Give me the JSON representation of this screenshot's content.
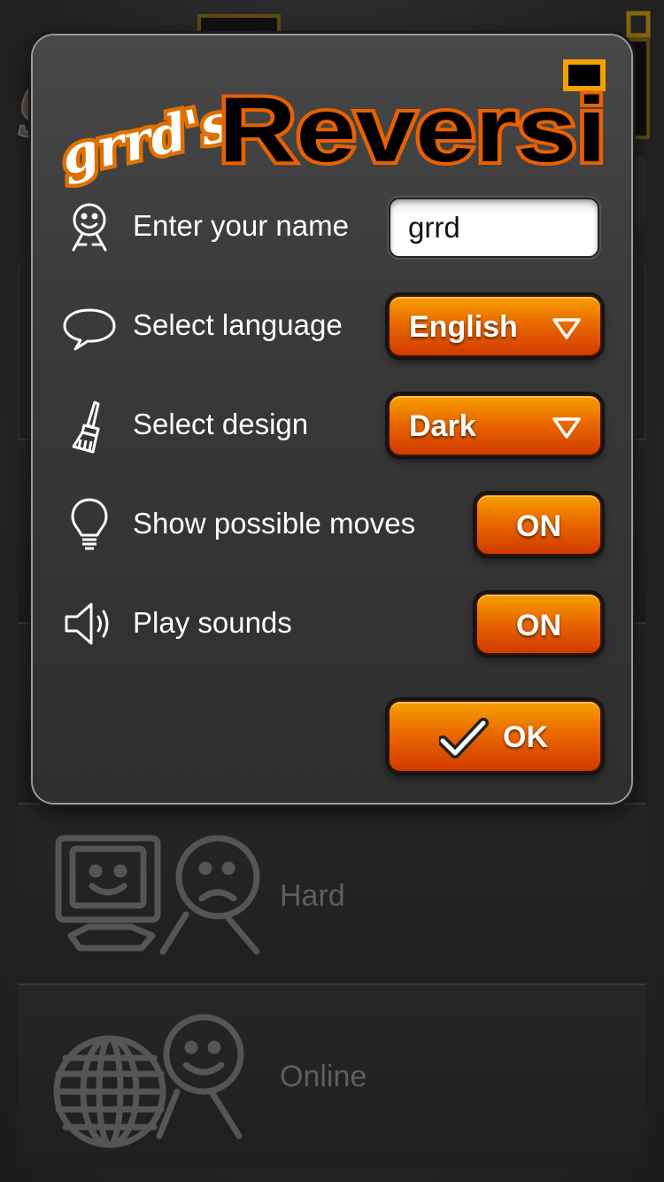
{
  "app": {
    "logo_prefix": "grrd's",
    "logo_main": "Reversi"
  },
  "settings": {
    "name": {
      "label": "Enter your name",
      "value": "grrd",
      "icon": "smiley-person-icon"
    },
    "language": {
      "label": "Select language",
      "selected": "English",
      "icon": "speech-bubble-icon"
    },
    "design": {
      "label": "Select design",
      "selected": "Dark",
      "icon": "paintbrush-icon"
    },
    "possible_moves": {
      "label": "Show possible moves",
      "value": "ON",
      "icon": "lightbulb-icon"
    },
    "sounds": {
      "label": "Play sounds",
      "value": "ON",
      "icon": "speaker-icon"
    },
    "ok_label": "OK"
  },
  "background_menu": {
    "items": [
      {
        "label": "Hard",
        "icon": "computer-vs-sad-face-icon"
      },
      {
        "label": "Online",
        "icon": "globe-person-icon"
      }
    ]
  },
  "colors": {
    "accent_top": "#f6a000",
    "accent_bottom": "#d13a00",
    "dialog_bg": "#3a3a3a"
  }
}
